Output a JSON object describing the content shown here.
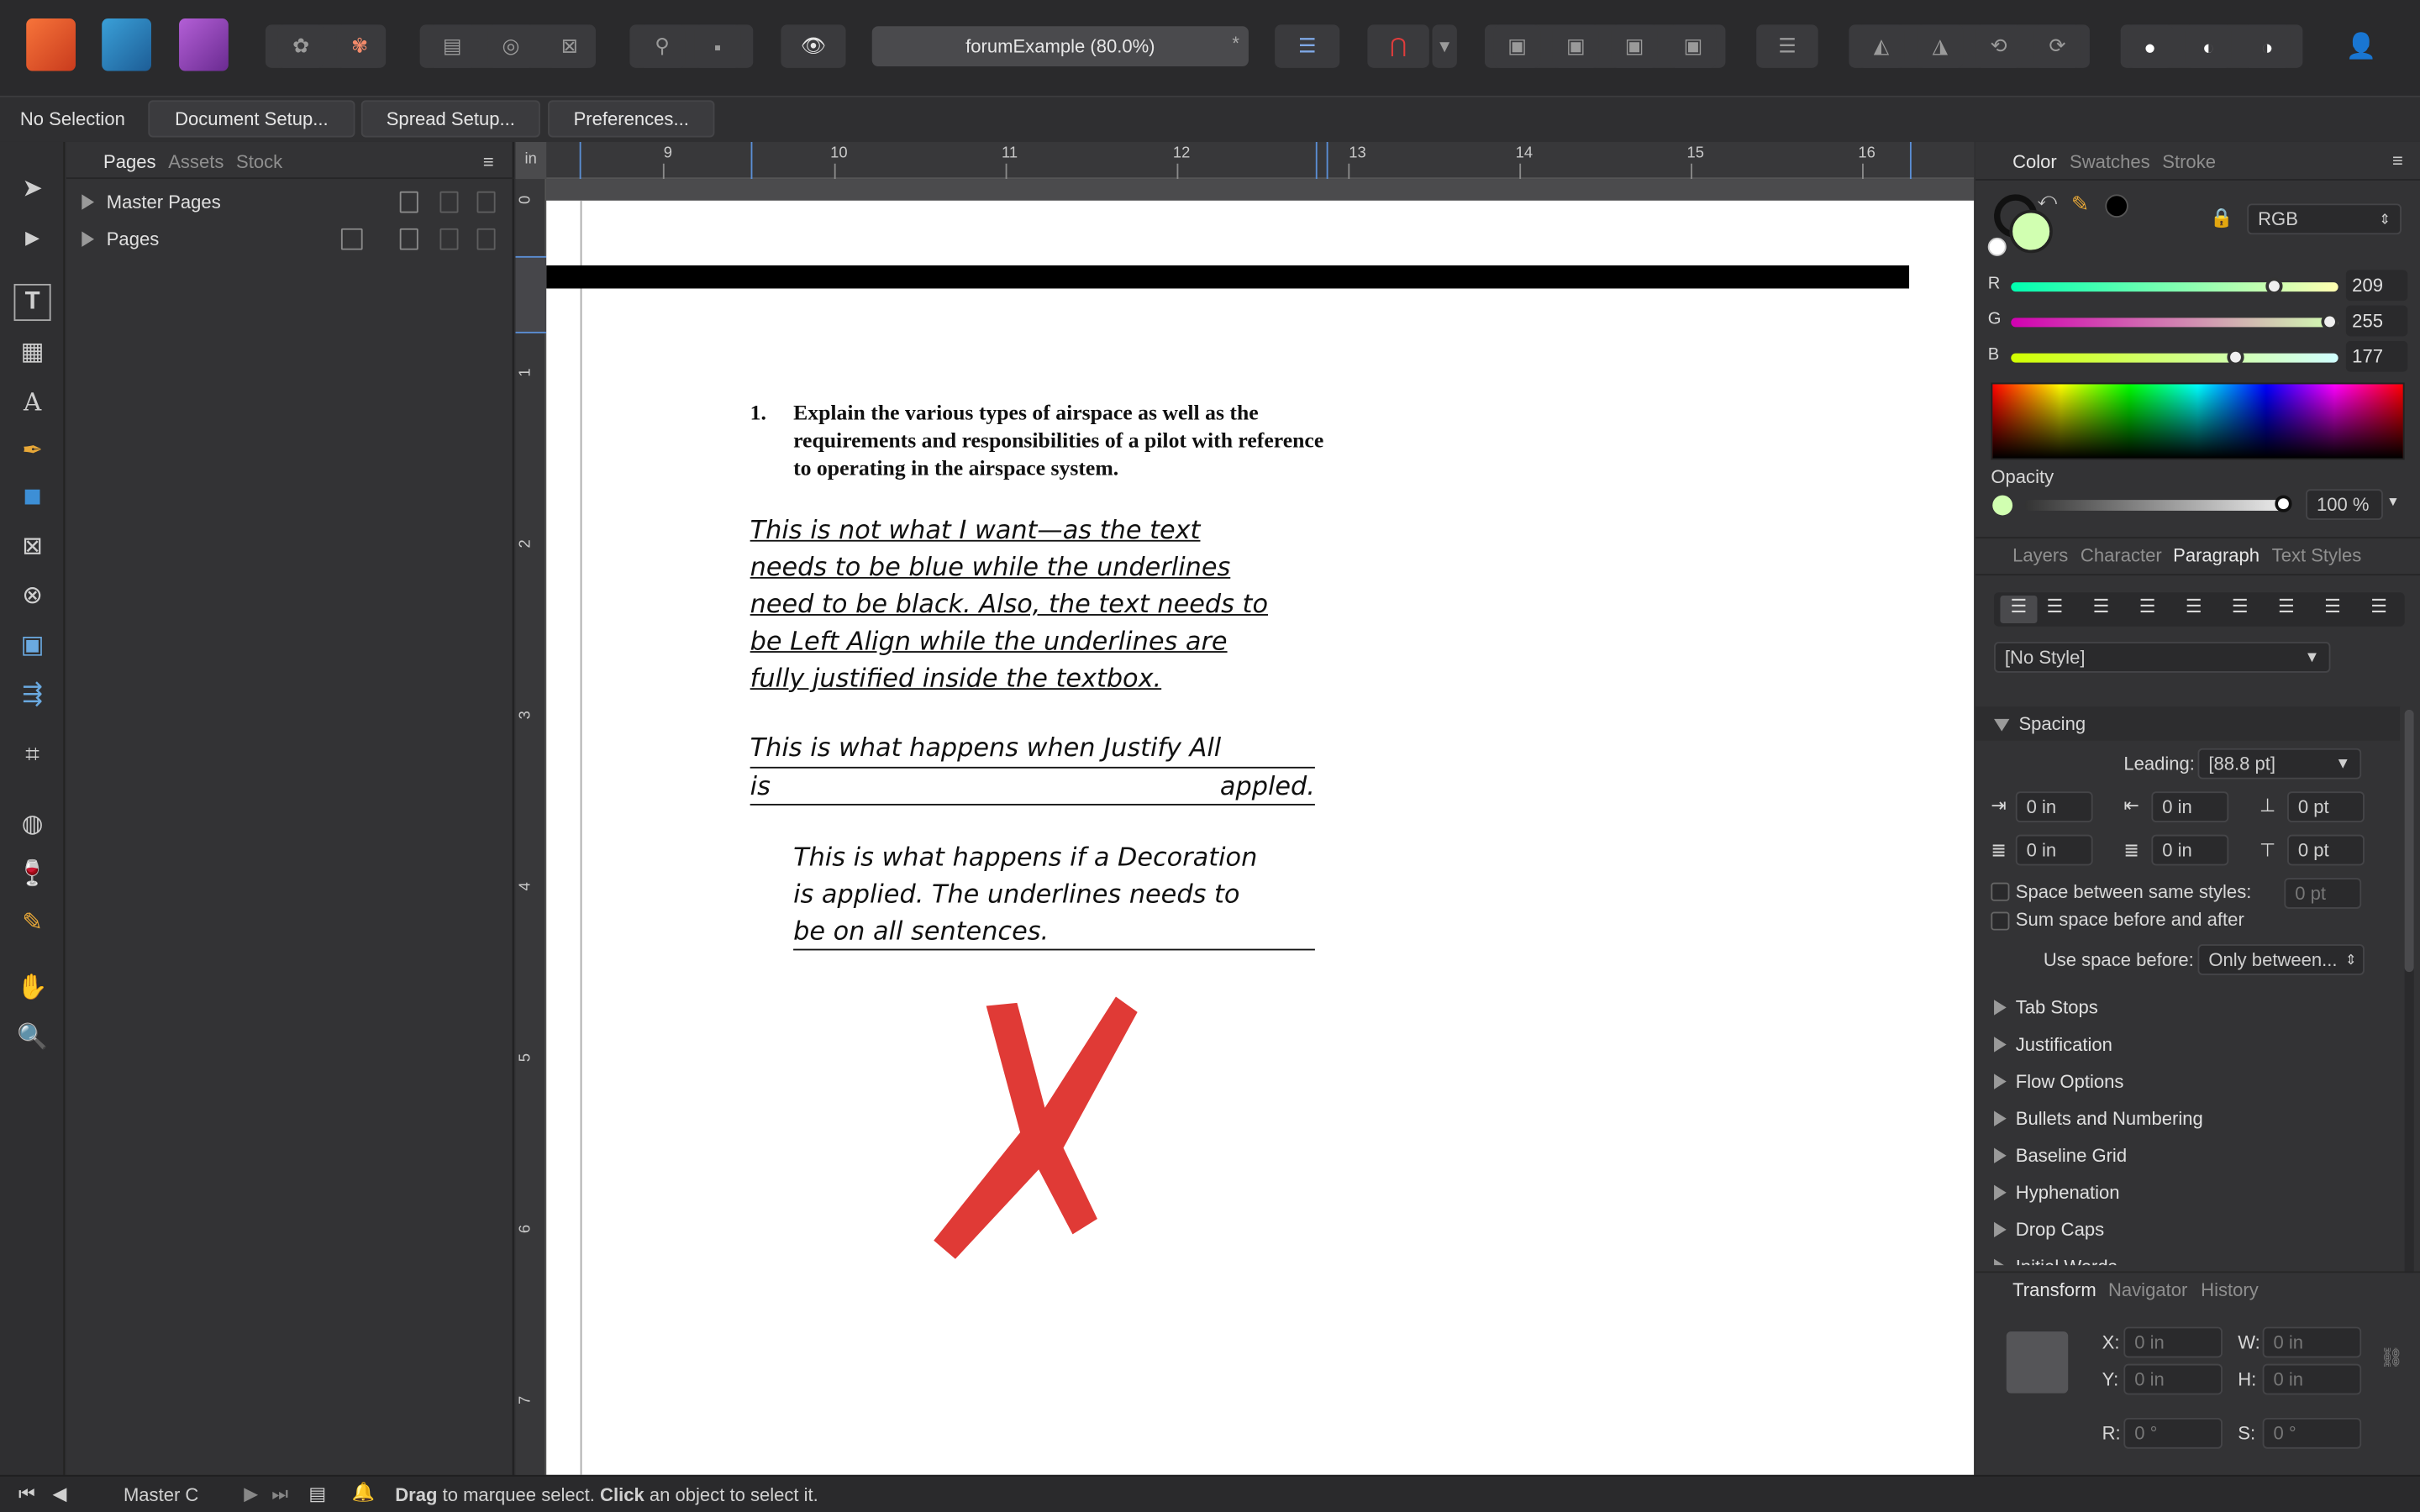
{
  "toolbar": {
    "doc_title": "forumExample (80.0%)",
    "modified_mark": "*",
    "icons": [
      "affinity-publisher-icon",
      "affinity-designer-icon",
      "affinity-photo-icon",
      "persona-icon",
      "persona-icon",
      "view-mode-icon",
      "preview-icon",
      "clip-icon",
      "pin-icon",
      "frame-icon",
      "hide-icon",
      "grid-icon",
      "snapping-magnet-icon",
      "arrange-icons",
      "align-icons",
      "flip-icons",
      "boolean-icons",
      "account-icon"
    ]
  },
  "context": {
    "selection_label": "No Selection",
    "document_setup": "Document Setup...",
    "spread_setup": "Spread Setup...",
    "preferences": "Preferences..."
  },
  "pages_panel": {
    "tabs": [
      "Pages",
      "Assets",
      "Stock"
    ],
    "rows": [
      "Master Pages",
      "Pages"
    ]
  },
  "ruler": {
    "unit": "in",
    "h_labels": [
      "9",
      "10",
      "11",
      "12",
      "13",
      "14",
      "15",
      "16"
    ],
    "v_labels": [
      "0",
      "1",
      "2",
      "3",
      "4",
      "5",
      "6",
      "7"
    ]
  },
  "document": {
    "question_number": "1.",
    "question_text": "Explain the various types of airspace as well as the requirements and responsibilities of a pilot with reference to operating in the airspace system.",
    "para1": [
      "This is not what I want—as the text",
      "needs to be blue while the underlines",
      "need to be black. Also, the text needs to",
      "be Left Align while the underlines are",
      "fully justified inside the textbox."
    ],
    "para2_line1": "This is what happens when Justify All",
    "para2_word_left": "is",
    "para2_word_right": "appled.",
    "para3": [
      "This is what happens if a Decoration",
      "is applied. The underlines needs to",
      "be on all sentences."
    ]
  },
  "color_panel": {
    "tabs": [
      "Color",
      "Swatches",
      "Stroke"
    ],
    "model": "RGB",
    "r_label": "R",
    "r_value": "209",
    "g_label": "G",
    "g_value": "255",
    "b_label": "B",
    "b_value": "177",
    "fill_color": "#d1ffb1",
    "opacity_label": "Opacity",
    "opacity_value": "100 %"
  },
  "paragraph_panel": {
    "tabs": [
      "Layers",
      "Character",
      "Paragraph",
      "Text Styles"
    ],
    "style": "[No Style]",
    "spacing_title": "Spacing",
    "leading_label": "Leading:",
    "leading_value": "[88.8 pt]",
    "indent_left": "0 in",
    "indent_first": "0 in",
    "space_before": "0 pt",
    "indent_right": "0 in",
    "indent_last": "0 in",
    "space_after": "0 pt",
    "same_styles_label": "Space between same styles:",
    "same_styles_value": "0 pt",
    "sum_space_label": "Sum space before and after",
    "use_space_label": "Use space before:",
    "use_space_value": "Only between...",
    "sections": [
      "Tab Stops",
      "Justification",
      "Flow Options",
      "Bullets and Numbering",
      "Baseline Grid",
      "Hyphenation",
      "Drop Caps",
      "Initial Words"
    ]
  },
  "transform_panel": {
    "tabs": [
      "Transform",
      "Navigator",
      "History"
    ],
    "x_label": "X:",
    "x_value": "0 in",
    "y_label": "Y:",
    "y_value": "0 in",
    "w_label": "W:",
    "w_value": "0 in",
    "h_label": "H:",
    "h_value": "0 in",
    "r_label": "R:",
    "r_value": "0 °",
    "s_label": "S:",
    "s_value": "0 °"
  },
  "status": {
    "page_name": "Master C",
    "drag_word": "Drag",
    "drag_text": "to marquee select.",
    "click_word": "Click",
    "click_text": "an object to select it."
  }
}
